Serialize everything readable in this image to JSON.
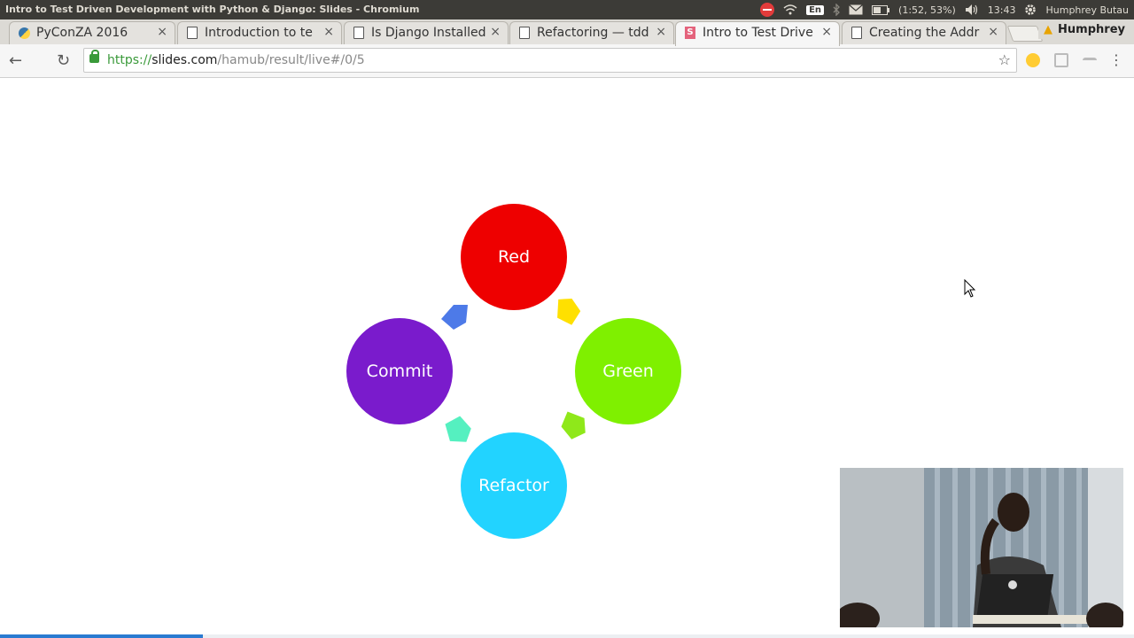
{
  "window": {
    "title": "Intro to Test Driven Development with Python & Django: Slides - Chromium"
  },
  "system": {
    "battery": "(1:52, 53%)",
    "clock": "13:43",
    "user": "Humphrey Butau",
    "keyboard_layout": "En"
  },
  "tabs": [
    {
      "label": "PyConZA 2016",
      "favicon": "python-icon",
      "active": false
    },
    {
      "label": "Introduction to te",
      "favicon": "document-icon",
      "active": false
    },
    {
      "label": "Is Django Installed",
      "favicon": "document-icon",
      "active": false
    },
    {
      "label": "Refactoring — tdd",
      "favicon": "document-icon",
      "active": false
    },
    {
      "label": "Intro to Test Drive",
      "favicon": "slides-icon",
      "active": true
    },
    {
      "label": "Creating the Addr",
      "favicon": "document-icon",
      "active": false
    }
  ],
  "profile": {
    "name": "Humphrey"
  },
  "address_bar": {
    "scheme": "https://",
    "host": "slides.com",
    "path": "/hamub/result/live#/0/5"
  },
  "slide": {
    "cycle": [
      {
        "label": "Red",
        "color": "#ee0000"
      },
      {
        "label": "Green",
        "color": "#7ff000"
      },
      {
        "label": "Refactor",
        "color": "#22d3ff"
      },
      {
        "label": "Commit",
        "color": "#7a1bcc"
      }
    ],
    "arrow_colors": [
      "#ffe000",
      "#8fe81a",
      "#55f0c0",
      "#4d7ae8"
    ]
  },
  "glyphs": {
    "close": "×",
    "back": "←",
    "reload": "↻",
    "star": "☆",
    "menu": "⋮",
    "warning": "▲"
  }
}
